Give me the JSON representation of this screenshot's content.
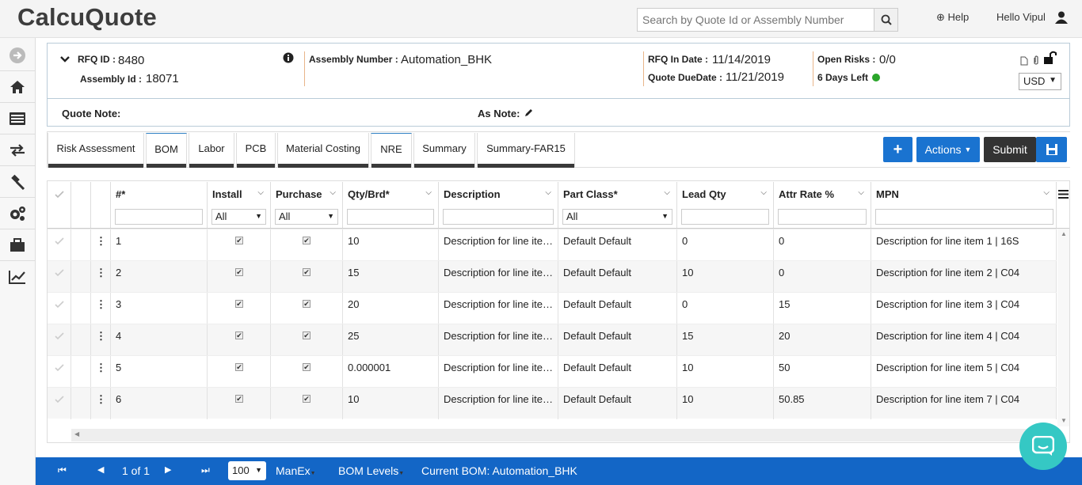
{
  "app": {
    "logo": "CalcuQuote"
  },
  "search": {
    "placeholder": "Search by Quote Id or Assembly Number"
  },
  "topnav": {
    "help": "Help",
    "greeting": "Hello Vipul"
  },
  "sidebar": {
    "items": [
      "arrow-right-icon",
      "home-icon",
      "list-icon",
      "transfer-icon",
      "gavel-icon",
      "cogs-icon",
      "briefcase-icon",
      "chart-line-icon"
    ]
  },
  "header": {
    "rfq_label": "RFQ ID :",
    "rfq_value": "8480",
    "assembly_id_label": "Assembly Id :",
    "assembly_id_value": "18071",
    "assembly_number_label": "Assembly Number :",
    "assembly_number_value": "Automation_BHK",
    "rfq_in_date_label": "RFQ In Date :",
    "rfq_in_date_value": "11/14/2019",
    "quote_due_label": "Quote DueDate :",
    "quote_due_value": "11/21/2019",
    "open_risks_label": "Open Risks :",
    "open_risks_value": "0/0",
    "days_left": "6 Days Left",
    "currency": "USD",
    "quote_note_label": "Quote Note:",
    "as_note_label": "As Note:"
  },
  "tabs": [
    "Risk Assessment",
    "BOM",
    "Labor",
    "PCB",
    "Material Costing",
    "NRE",
    "Summary",
    "Summary-FAR15"
  ],
  "active_tab": "BOM",
  "toolbar": {
    "add": "+",
    "actions": "Actions",
    "submit": "Submit"
  },
  "grid": {
    "columns": [
      "#*",
      "Install",
      "Purchase",
      "Qty/Brd*",
      "Description",
      "Part Class*",
      "Lead Qty",
      "Attr Rate %",
      "MPN"
    ],
    "filters": {
      "install": "All",
      "purchase": "All",
      "part_class": "All"
    },
    "rows": [
      {
        "num": "1",
        "qty": "10",
        "desc": "Description for line item 1",
        "part_class": "Default Default",
        "lead": "0",
        "attr": "0",
        "mpn": "Description for line item 1 | 16S"
      },
      {
        "num": "2",
        "qty": "15",
        "desc": "Description for line item 2",
        "part_class": "Default Default",
        "lead": "10",
        "attr": "0",
        "mpn": "Description for line item 2 | C04"
      },
      {
        "num": "3",
        "qty": "20",
        "desc": "Description for line item 3",
        "part_class": "Default Default",
        "lead": "0",
        "attr": "15",
        "mpn": "Description for line item 3 | C04"
      },
      {
        "num": "4",
        "qty": "25",
        "desc": "Description for line item 4",
        "part_class": "Default Default",
        "lead": "15",
        "attr": "20",
        "mpn": "Description for line item 4 | C04"
      },
      {
        "num": "5",
        "qty": "0.000001",
        "desc": "Description for line item 5",
        "part_class": "Default Default",
        "lead": "10",
        "attr": "50",
        "mpn": "Description for line item 5 | C04"
      },
      {
        "num": "6",
        "qty": "10",
        "desc": "Description for line item 7",
        "part_class": "Default Default",
        "lead": "10",
        "attr": "50.85",
        "mpn": "Description for line item 7 | C04"
      }
    ]
  },
  "footer": {
    "page": "1 of 1",
    "page_size": "100",
    "manex": "ManEx",
    "bom_levels": "BOM Levels",
    "current_bom": "Current BOM: Automation_BHK"
  },
  "colors": {
    "primary": "#1a73d0",
    "footer": "#1366c6",
    "chat": "#35c8c4",
    "submit": "#333333"
  }
}
